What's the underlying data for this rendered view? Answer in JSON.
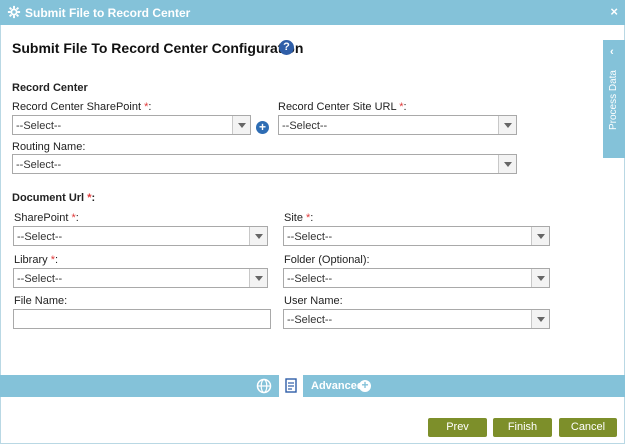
{
  "window": {
    "title": "Submit File to Record Center",
    "close_glyph": "×"
  },
  "page": {
    "title": "Submit File To Record Center Configuration",
    "help_glyph": "?"
  },
  "record_center": {
    "heading": "Record Center",
    "sharepoint": {
      "label": "Record Center SharePoint ",
      "required": "*",
      "colon": ":",
      "value": "--Select--"
    },
    "site_url": {
      "label": "Record Center Site URL ",
      "required": "*",
      "colon": ":",
      "value": "--Select--"
    },
    "routing_name": {
      "label": "Routing Name:",
      "value": "--Select--"
    }
  },
  "document_url": {
    "heading": "Document Url ",
    "required": "*",
    "colon": ":",
    "sharepoint": {
      "label": "SharePoint ",
      "required": "*",
      "colon": ":",
      "value": "--Select--"
    },
    "site": {
      "label": "Site ",
      "required": "*",
      "colon": ":",
      "value": "--Select--"
    },
    "library": {
      "label": "Library ",
      "required": "*",
      "colon": ":",
      "value": "--Select--"
    },
    "folder": {
      "label": "Folder (Optional):",
      "value": "--Select--"
    },
    "file_name": {
      "label": "File Name:",
      "value": ""
    },
    "user_name": {
      "label": "User Name:",
      "value": "--Select--"
    }
  },
  "side_panel": {
    "label": "Process Data",
    "chevron": "‹"
  },
  "bottom_bar": {
    "advanced_label": "Advanced",
    "plus_glyph": "+"
  },
  "buttons": {
    "prev": "Prev",
    "finish": "Finish",
    "cancel": "Cancel"
  },
  "colors": {
    "accent": "#84c2d9",
    "button": "#7d8f2a",
    "required": "#e03a3a",
    "help": "#2f5ea8"
  }
}
